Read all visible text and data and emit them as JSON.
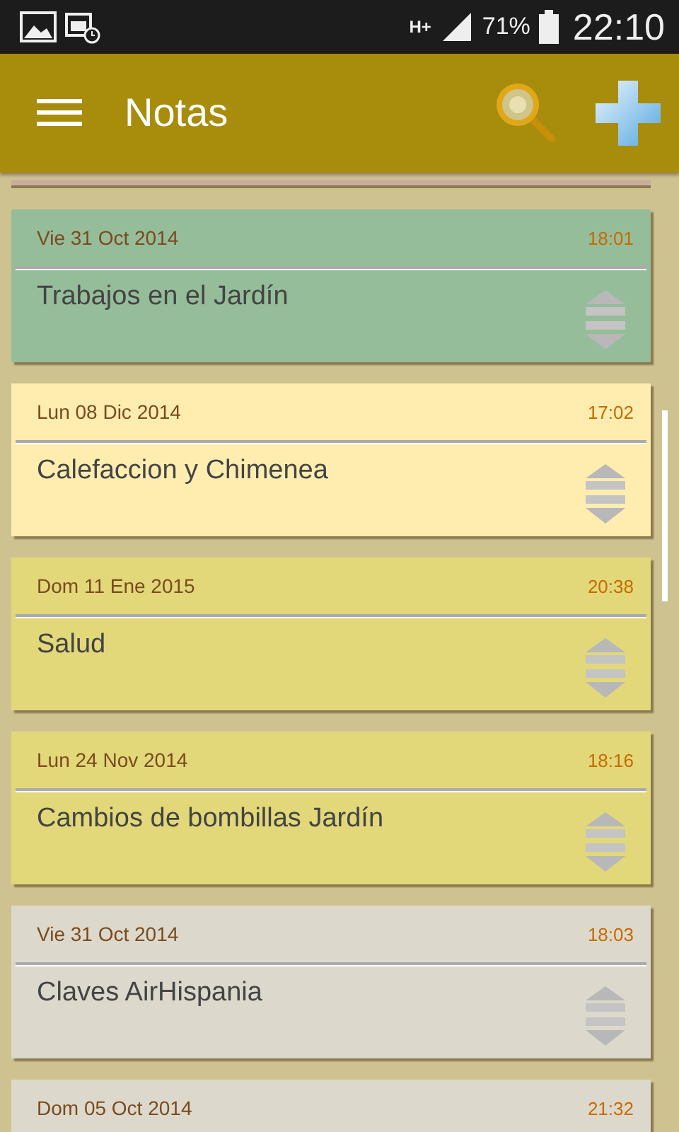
{
  "status_bar": {
    "network": "H+",
    "battery": "71%",
    "time": "22:10"
  },
  "app_bar": {
    "title": "Notas"
  },
  "notes": [
    {
      "date": "Vie 31 Oct 2014",
      "time": "18:01",
      "title": "Trabajos en el Jardín",
      "color": "#95bd9a"
    },
    {
      "date": "Lun 08 Dic 2014",
      "time": "17:02",
      "title": "Calefaccion y Chimenea",
      "color": "#ffedb0"
    },
    {
      "date": "Dom 11 Ene 2015",
      "time": "20:38",
      "title": "Salud",
      "color": "#e2d87a"
    },
    {
      "date": "Lun 24 Nov 2014",
      "time": "18:16",
      "title": "Cambios de bombillas Jardín",
      "color": "#e2d87a"
    },
    {
      "date": "Vie 31 Oct 2014",
      "time": "18:03",
      "title": "Claves AirHispania",
      "color": "#dcd9cc"
    },
    {
      "date": "Dom 05 Oct 2014",
      "time": "21:32",
      "color": "#dcd9cc"
    }
  ]
}
